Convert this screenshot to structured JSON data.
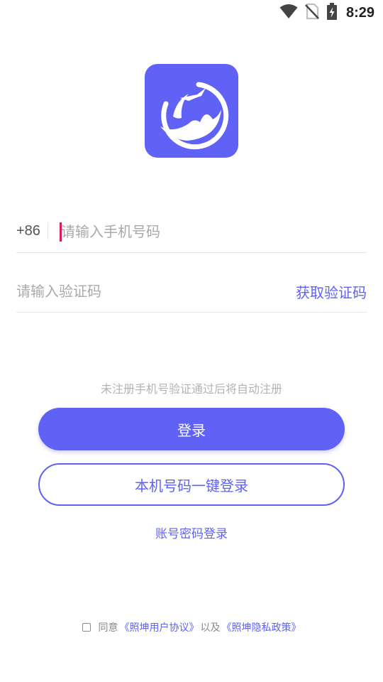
{
  "status_bar": {
    "time": "8:29",
    "icons": [
      "wifi-icon",
      "no-sim-icon",
      "battery-charging-icon"
    ]
  },
  "app": {
    "logo_icon": "app-logo-icon",
    "brand_color": "#5f62f5"
  },
  "phone_field": {
    "country_code": "+86",
    "placeholder": "请输入手机号码",
    "value": ""
  },
  "code_field": {
    "placeholder": "请输入验证码",
    "value": "",
    "get_code_label": "获取验证码"
  },
  "hint": "未注册手机号验证通过后将自动注册",
  "login_button_label": "登录",
  "onekey_login_label": "本机号码一键登录",
  "password_login_label": "账号密码登录",
  "agreement": {
    "checked": false,
    "prefix": "同意",
    "user_agreement": "《照坤用户协议》",
    "middle": "以及",
    "privacy_policy": "《照坤隐私政策》"
  }
}
